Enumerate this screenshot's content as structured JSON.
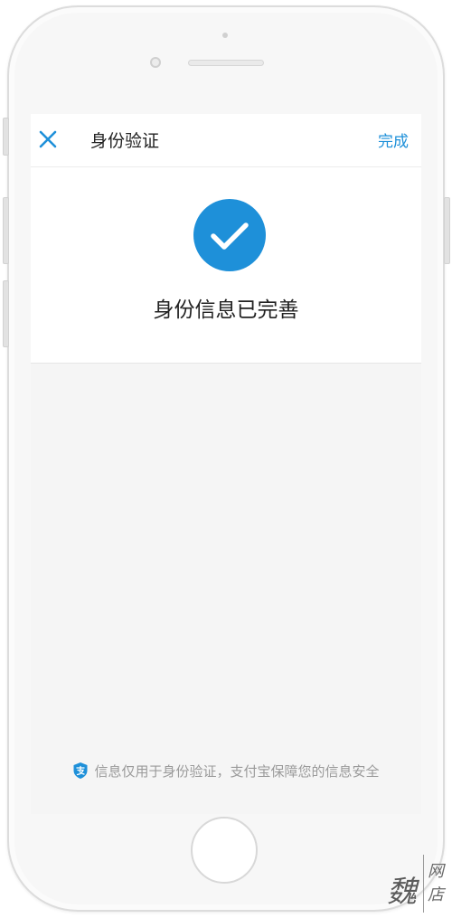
{
  "nav": {
    "title": "身份验证",
    "done_label": "完成",
    "close_icon": "close-icon"
  },
  "result": {
    "icon": "check-circle-icon",
    "icon_color": "#1e90d9",
    "message": "身份信息已完善"
  },
  "footer": {
    "icon": "alipay-shield-icon",
    "note": "信息仅用于身份验证，支付宝保障您的信息安全"
  },
  "watermark": {
    "big_char": "魏",
    "small_top": "网",
    "small_bottom": "店"
  },
  "colors": {
    "accent": "#1e90d9",
    "background": "#f5f5f5",
    "text_primary": "#222222",
    "text_secondary": "#9a9a9a"
  }
}
